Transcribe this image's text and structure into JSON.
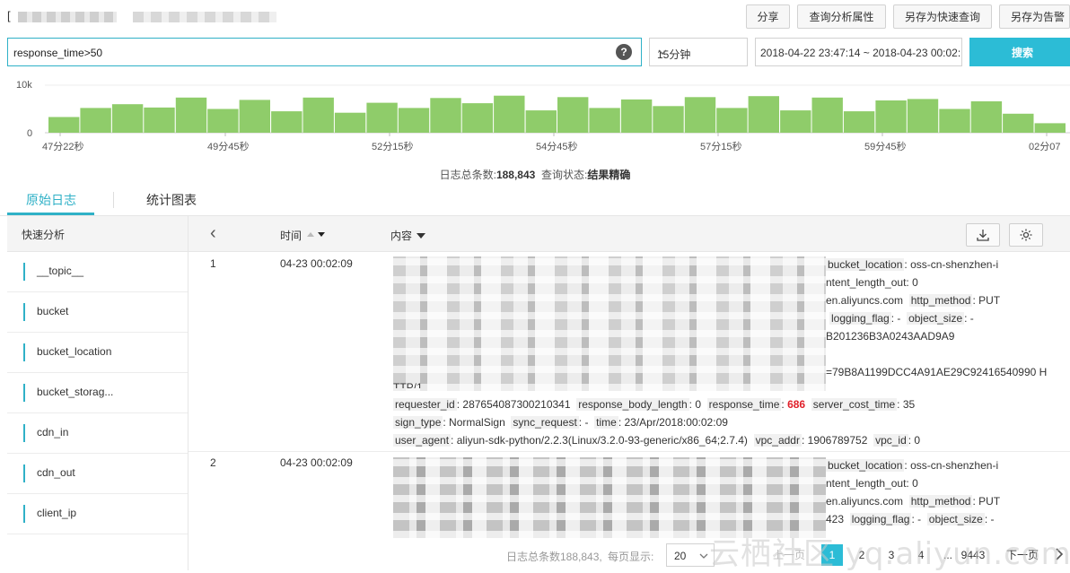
{
  "toolbar": {
    "title_prefix": "[",
    "share": "分享",
    "query_props": "查询分析属性",
    "save_quick": "另存为快速查询",
    "save_alert": "另存为告警"
  },
  "search": {
    "query": "response_time>50",
    "help": "?",
    "range_select": "15分钟",
    "date_range": "2018-04-22 23:47:14 ~ 2018-04-23 00:02:14",
    "button": "搜索"
  },
  "histogram": {
    "y_top": "10k",
    "y_zero": "0",
    "x_labels": [
      "47分22秒",
      "49分45秒",
      "52分15秒",
      "54分45秒",
      "57分15秒",
      "59分45秒",
      "02分07"
    ],
    "bar_color": "#8fcc6a",
    "values": [
      0.33,
      0.52,
      0.6,
      0.53,
      0.74,
      0.5,
      0.69,
      0.45,
      0.74,
      0.42,
      0.63,
      0.52,
      0.73,
      0.62,
      0.78,
      0.47,
      0.75,
      0.52,
      0.7,
      0.56,
      0.75,
      0.52,
      0.77,
      0.47,
      0.74,
      0.45,
      0.68,
      0.71,
      0.5,
      0.66,
      0.4,
      0.2
    ]
  },
  "summary": {
    "total_label": "日志总条数:",
    "total": "188,843",
    "status_label": "查询状态:",
    "status": "结果精确"
  },
  "tabs": {
    "raw": "原始日志",
    "chart": "统计图表"
  },
  "sidebar": {
    "title": "快速分析",
    "items": [
      "__topic__",
      "bucket",
      "bucket_location",
      "bucket_storag...",
      "cdn_in",
      "cdn_out",
      "client_ip"
    ]
  },
  "table": {
    "back": "‹",
    "col_time": "时间",
    "col_content": "内容"
  },
  "rows": [
    {
      "index": "1",
      "time": "04-23 00:02:09",
      "lines": {
        "l1": {
          "k": "bucket_location",
          "v": "oss-cn-shenzhen-i"
        },
        "l2": "ntent_length_out:  0",
        "l3a": "en.aliyuncs.com",
        "l3k": "http_method",
        "l3v": "PUT",
        "l4k": "logging_flag",
        "l4v": "-",
        "l4k2": "object_size",
        "l4v2": "-",
        "l5": "B201236B3A0243AAD9A9",
        "l6": "=79B8A1199DCC4A91AE29C92416540990  H",
        "l6b": "TTP/1.",
        "r1": [
          {
            "k": "requester_id",
            "v": "287654087300210341"
          },
          {
            "k": "response_body_length",
            "v": "0"
          },
          {
            "k": "response_time",
            "v": "686"
          },
          {
            "k": "server_cost_time",
            "v": "35"
          }
        ],
        "r2": [
          {
            "k": "sign_type",
            "v": "NormalSign"
          },
          {
            "k": "sync_request",
            "v": "-"
          },
          {
            "k": "time",
            "v": "23/Apr/2018:00:02:09"
          }
        ],
        "r3": [
          {
            "k": "user_agent",
            "v": "aliyun-sdk-python/2.2.3(Linux/3.2.0-93-generic/x86_64;2.7.4)"
          },
          {
            "k": "vpc_addr",
            "v": "1906789752"
          },
          {
            "k": "vpc_id",
            "v": "0"
          }
        ]
      }
    },
    {
      "index": "2",
      "time": "04-23 00:02:09",
      "lines": {
        "l1": {
          "k": "bucket_location",
          "v": "oss-cn-shenzhen-i"
        },
        "l2": "ntent_length_out:  0",
        "l3a": "en.aliyuncs.com",
        "l3k": "http_method",
        "l3v": "PUT",
        "l4a": "423",
        "l4k": "logging_flag",
        "l4v": "-",
        "l4k2": "object_size",
        "l4v2": "-"
      }
    }
  ],
  "pager": {
    "total_text": "日志总条数188,843,",
    "per_page_label": "每页显示:",
    "per_page": "20",
    "prev": "上一页",
    "pages": [
      "1",
      "2",
      "3",
      "4",
      "...",
      "9443"
    ],
    "next": "下一页"
  },
  "watermark": "云栖社区 yq.aliyun.com"
}
